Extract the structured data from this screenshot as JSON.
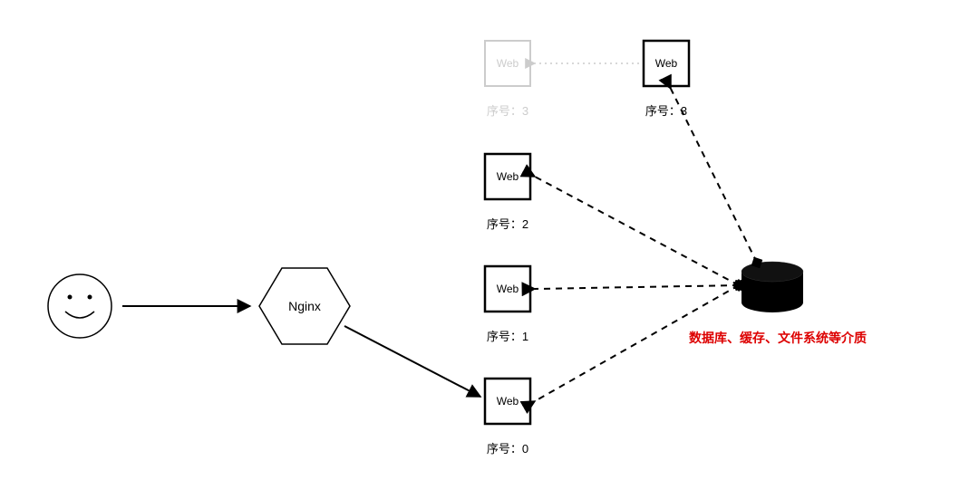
{
  "user": {
    "label": ""
  },
  "nginx": {
    "label": "Nginx"
  },
  "web_nodes": [
    {
      "label": "Web",
      "caption": "序号：0",
      "faded": false
    },
    {
      "label": "Web",
      "caption": "序号：1",
      "faded": false
    },
    {
      "label": "Web",
      "caption": "序号：2",
      "faded": false
    },
    {
      "label": "Web",
      "caption": "序号：3",
      "faded": true
    },
    {
      "label": "Web",
      "caption": "序号：3",
      "faded": false
    }
  ],
  "storage": {
    "label": "数据库、缓存、文件系统等介质"
  }
}
